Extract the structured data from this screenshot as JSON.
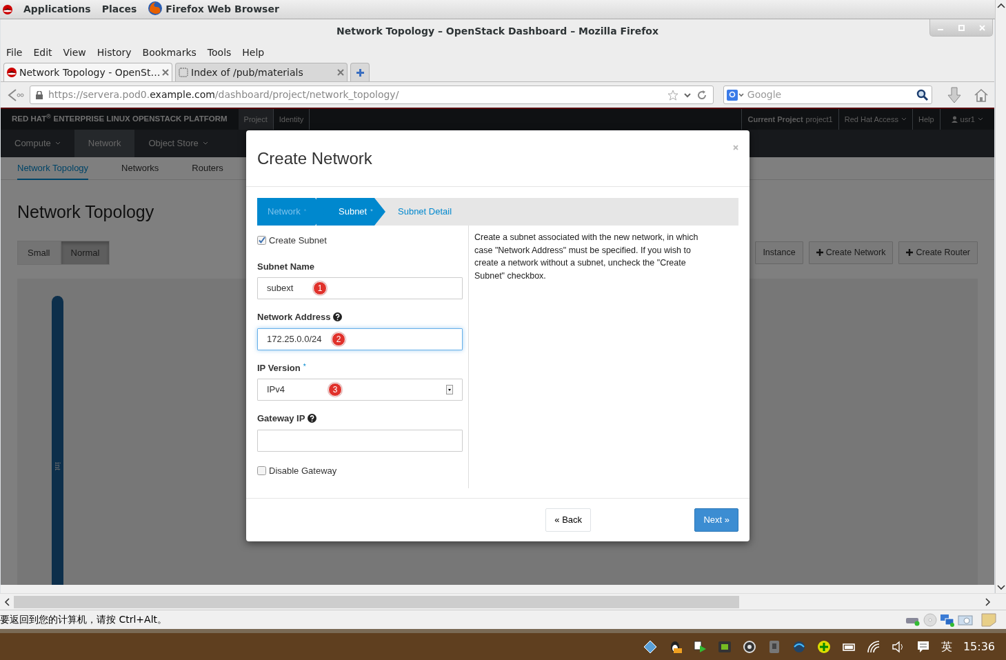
{
  "top_bar": {
    "menus": [
      "Applications",
      "Places"
    ],
    "app": "Firefox Web Browser"
  },
  "window": {
    "title": "Network Topology – OpenStack Dashboard – Mozilla Firefox"
  },
  "menu_bar": [
    "File",
    "Edit",
    "View",
    "History",
    "Bookmarks",
    "Tools",
    "Help"
  ],
  "tabs": [
    {
      "label": "Network Topology - OpenSt…",
      "selected": true
    },
    {
      "label": "Index of /pub/materials",
      "selected": false
    }
  ],
  "address": {
    "url_start": "https://servera.pod0.",
    "url_domain": "example.com",
    "url_path": "/dashboard/project/network_topology/"
  },
  "search": {
    "placeholder": "Google"
  },
  "dashboard": {
    "brand": "RED HAT$^{®}$ ENTERPRISE LINUX OPENSTACK PLATFORM",
    "switcher": [
      {
        "label": "Project",
        "selected": true
      },
      {
        "label": "Identity",
        "selected": false
      }
    ],
    "current_project_label": "Current Project",
    "current_project": "project1",
    "links": [
      "Red Hat Access",
      "Help"
    ],
    "user": "usr1",
    "panel_groups": [
      {
        "label": "Compute",
        "dropdown": true,
        "selected": false
      },
      {
        "label": "Network",
        "dropdown": false,
        "selected": true
      },
      {
        "label": "Object Store",
        "dropdown": true,
        "selected": false
      }
    ],
    "subnav": [
      {
        "label": "Network Topology",
        "selected": true
      },
      {
        "label": "Networks",
        "selected": false
      },
      {
        "label": "Routers",
        "selected": false
      }
    ],
    "page_title": "Network Topology",
    "size_toggle": [
      {
        "label": "Small",
        "selected": false
      },
      {
        "label": "Normal",
        "selected": true
      }
    ],
    "actions": [
      {
        "label": "Instance",
        "icon": false
      },
      {
        "label": "Create Network",
        "icon": true
      },
      {
        "label": "Create Router",
        "icon": true
      }
    ],
    "network_label": "int"
  },
  "modal": {
    "title": "Create Network",
    "required_mark": "*",
    "steps": [
      {
        "label": "Network",
        "required": true,
        "completed": true,
        "selected": false
      },
      {
        "label": "Subnet",
        "required": true,
        "completed": false,
        "selected": true
      },
      {
        "label": "Subnet Detail",
        "required": false,
        "completed": false,
        "selected": false
      }
    ],
    "create_subnet": {
      "label": "Create Subnet",
      "checked": true
    },
    "fields": [
      {
        "kind": "text",
        "label": "Subnet Name",
        "required": false,
        "help": false,
        "focused": false,
        "value": "subext",
        "marker": "1"
      },
      {
        "kind": "text",
        "label": "Network Address",
        "required": false,
        "help": true,
        "focused": true,
        "value": "172.25.0.0/24",
        "marker": "2"
      },
      {
        "kind": "select",
        "label": "IP Version",
        "required": true,
        "help": false,
        "focused": false,
        "value": "IPv4",
        "marker": "3"
      },
      {
        "kind": "text",
        "label": "Gateway IP",
        "required": false,
        "help": true,
        "focused": false
      }
    ],
    "disable_gateway": {
      "label": "Disable Gateway",
      "checked": false
    },
    "help_text": "Create a subnet associated with the new network, in which case \"Network Address\" must be specified. If you wish to create a network without a subnet, uncheck the \"Create Subnet\" checkbox.",
    "back_button": "« Back",
    "next_button": "Next »"
  },
  "status_bar": {
    "text": "要返回到您的计算机，请按 Ctrl+Alt。"
  },
  "taskbar": {
    "ime": "英",
    "clock": "15:36"
  }
}
